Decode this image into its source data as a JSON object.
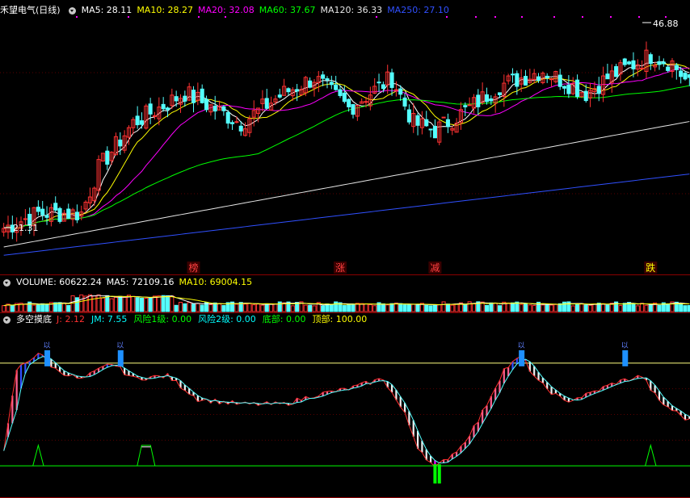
{
  "stock_panel": {
    "name": "禾望电气(日线)",
    "ma_labels": [
      {
        "text": "MA5: 28.11",
        "color": "#ffffff"
      },
      {
        "text": "MA10: 28.27",
        "color": "#ffff00"
      },
      {
        "text": "MA20: 32.08",
        "color": "#ff00ff"
      },
      {
        "text": "MA60: 37.67",
        "color": "#00ff00"
      },
      {
        "text": "MA120: 36.33",
        "color": "#e6e6e6"
      },
      {
        "text": "MA250: 27.10",
        "color": "#3050ff"
      }
    ],
    "high_label": "46.88",
    "low_label": "21.31",
    "signals": [
      {
        "text": "榜",
        "index": 44
      },
      {
        "text": "涨",
        "index": 78
      },
      {
        "text": "减",
        "index": 100
      },
      {
        "text": "跌",
        "index": 150
      }
    ]
  },
  "volume_panel": {
    "labels": [
      {
        "text": "VOLUME: 60622.24",
        "color": "#ffffff"
      },
      {
        "text": "MA5: 72109.16",
        "color": "#ffffff"
      },
      {
        "text": "MA10: 69004.15",
        "color": "#ffff00"
      }
    ]
  },
  "indicator_panel": {
    "title": "多空摸底",
    "labels": [
      {
        "text": "J: 2.12",
        "color": "#ff3030"
      },
      {
        "text": "JM: 7.55",
        "color": "#00ffff"
      },
      {
        "text": "风险1级: 0.00",
        "color": "#00ff00"
      },
      {
        "text": "风险2级: 0.00",
        "color": "#00ffff"
      },
      {
        "text": "底部: 0.00",
        "color": "#00ff00"
      },
      {
        "text": "顶部: 100.00",
        "color": "#ffff00"
      }
    ],
    "top_marker_text": "以",
    "top_markers": [
      10,
      27,
      120,
      144
    ]
  },
  "chart_data": {
    "type": "candlestick",
    "price_ylim": [
      18,
      50
    ],
    "volume_ylim": [
      0,
      160000
    ],
    "indicator_ylim": [
      -10,
      110
    ],
    "bars": 160,
    "price_anchors": [
      [
        0,
        22
      ],
      [
        8,
        24
      ],
      [
        18,
        24
      ],
      [
        22,
        30
      ],
      [
        30,
        36
      ],
      [
        42,
        40
      ],
      [
        55,
        36
      ],
      [
        65,
        40
      ],
      [
        72,
        42
      ],
      [
        80,
        38
      ],
      [
        90,
        42
      ],
      [
        95,
        36
      ],
      [
        100,
        35
      ],
      [
        108,
        38
      ],
      [
        115,
        41
      ],
      [
        125,
        43
      ],
      [
        135,
        40
      ],
      [
        140,
        42
      ],
      [
        150,
        45
      ],
      [
        155,
        44
      ],
      [
        159,
        41
      ]
    ],
    "indicator_anchors": [
      [
        0,
        20
      ],
      [
        3,
        85
      ],
      [
        8,
        98
      ],
      [
        12,
        85
      ],
      [
        18,
        77
      ],
      [
        25,
        90
      ],
      [
        30,
        78
      ],
      [
        38,
        80
      ],
      [
        45,
        62
      ],
      [
        55,
        58
      ],
      [
        65,
        58
      ],
      [
        72,
        65
      ],
      [
        80,
        70
      ],
      [
        88,
        78
      ],
      [
        93,
        50
      ],
      [
        96,
        25
      ],
      [
        100,
        8
      ],
      [
        106,
        25
      ],
      [
        110,
        45
      ],
      [
        116,
        85
      ],
      [
        120,
        95
      ],
      [
        124,
        75
      ],
      [
        130,
        60
      ],
      [
        135,
        65
      ],
      [
        142,
        75
      ],
      [
        148,
        80
      ],
      [
        152,
        60
      ],
      [
        159,
        45
      ]
    ]
  }
}
